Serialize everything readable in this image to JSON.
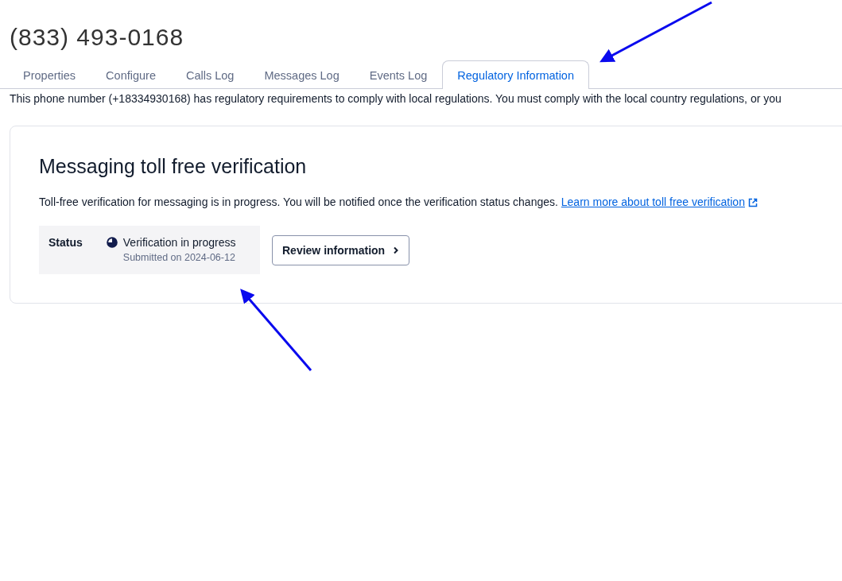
{
  "title": "(833) 493-0168",
  "tabs": [
    {
      "label": "Properties",
      "selected": false
    },
    {
      "label": "Configure",
      "selected": false
    },
    {
      "label": "Calls Log",
      "selected": false
    },
    {
      "label": "Messages Log",
      "selected": false
    },
    {
      "label": "Events Log",
      "selected": false
    },
    {
      "label": "Regulatory Information",
      "selected": true
    }
  ],
  "notice": "This phone number (+18334930168) has regulatory requirements to comply with local regulations. You must comply with the local country regulations, or you",
  "card": {
    "heading": "Messaging toll free verification",
    "description": "Toll-free verification for messaging is in progress. You will be notified once the verification status changes.",
    "link": "Learn more about toll free verification",
    "status": {
      "label": "Status",
      "value": "Verification in progress",
      "submitted": "Submitted on 2024-06-12"
    },
    "button": "Review information"
  }
}
